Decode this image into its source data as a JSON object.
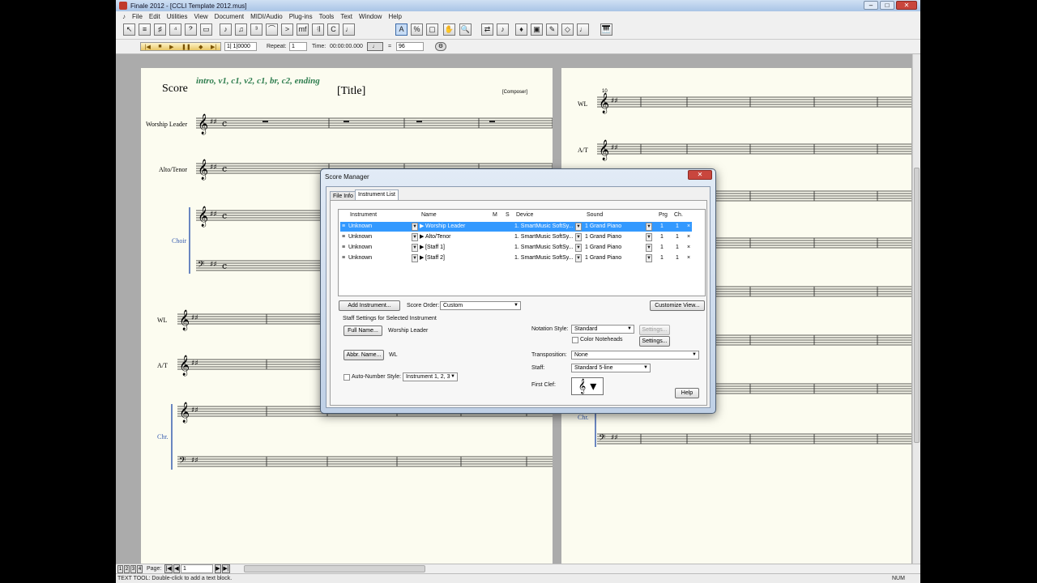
{
  "window": {
    "title": "Finale 2012 - [CCLI Template 2012.mus]"
  },
  "menu": [
    "File",
    "Edit",
    "Utilities",
    "View",
    "Document",
    "MIDI/Audio",
    "Plug-ins",
    "Tools",
    "Text",
    "Window",
    "Help"
  ],
  "tool_icons": [
    "selection-tool-icon",
    "staff-tool-icon",
    "key-signature-icon",
    "time-signature-icon",
    "clef-icon",
    "measure-icon",
    "simple-entry-icon",
    "speedy-entry-icon",
    "tuplet-icon",
    "smart-shape-icon",
    "articulation-icon",
    "expression-icon",
    "repeat-icon",
    "chord-icon",
    "lyrics-icon",
    "text-icon",
    "resize-icon",
    "page-layout-icon",
    "hand-grabber-icon",
    "zoom-icon",
    "mirror-icon",
    "note-mover-icon",
    "special-tools-icon",
    "graphics-icon",
    "mass-edit-icon",
    "ossia-icon",
    "tempo-icon",
    "hyperscribe-icon"
  ],
  "playback": {
    "measure": "1| 1|0000",
    "repeat_label": "Repeat:",
    "repeat_value": "1",
    "time_label": "Time:",
    "time_value": "00:00:00.000",
    "tempo_equals": "=",
    "tempo_value": "96"
  },
  "score": {
    "title_label": "Score",
    "form": "intro, v1, c1, v2, c1, br, c2, ending",
    "title": "[Title]",
    "composer": "[Composer]",
    "page1_staves": [
      "Worship Leader",
      "Alto/Tenor",
      "Choir",
      "WL",
      "A/T",
      "Chr."
    ],
    "page2_staves": [
      "WL",
      "A/T",
      "Chr."
    ],
    "measure_number": "10"
  },
  "dialog": {
    "title": "Score Manager",
    "tabs": [
      "File Info",
      "Instrument List"
    ],
    "active_tab": "Instrument List",
    "columns": {
      "instrument": "Instrument",
      "name": "Name",
      "m": "M",
      "s": "S",
      "device": "Device",
      "sound": "Sound",
      "prg": "Prg",
      "ch": "Ch."
    },
    "rows": [
      {
        "instrument": "Unknown",
        "name": "Worship Leader",
        "device": "1. SmartMusic SoftSy...",
        "sound": "1 Grand Piano",
        "prg": "1",
        "ch": "1",
        "x": "×"
      },
      {
        "instrument": "Unknown",
        "name": "Alto/Tenor",
        "device": "1. SmartMusic SoftSy...",
        "sound": "1 Grand Piano",
        "prg": "1",
        "ch": "1",
        "x": "×"
      },
      {
        "instrument": "Unknown",
        "name": "[Staff 1]",
        "device": "1. SmartMusic SoftSy...",
        "sound": "1 Grand Piano",
        "prg": "1",
        "ch": "1",
        "x": "×"
      },
      {
        "instrument": "Unknown",
        "name": "[Staff 2]",
        "device": "1. SmartMusic SoftSy...",
        "sound": "1 Grand Piano",
        "prg": "1",
        "ch": "1",
        "x": "×"
      }
    ],
    "add_instrument": "Add Instrument...",
    "score_order_label": "Score Order:",
    "score_order_value": "Custom",
    "customize_view": "Customize View...",
    "staff_settings_label": "Staff Settings for Selected Instrument",
    "full_name_btn": "Full Name...",
    "full_name_value": "Worship Leader",
    "abbr_name_btn": "Abbr. Name...",
    "abbr_name_value": "WL",
    "auto_number_label": "Auto-Number Style:",
    "auto_number_value": "Instrument 1, 2, 3",
    "notation_style_label": "Notation Style:",
    "notation_style_value": "Standard",
    "settings_btn": "Settings...",
    "color_noteheads_label": "Color Noteheads",
    "transposition_label": "Transposition:",
    "transposition_value": "None",
    "staff_label": "Staff:",
    "staff_value": "Standard 5-line",
    "first_clef_label": "First Clef:",
    "help_btn": "Help"
  },
  "page_nav": {
    "label": "Page:",
    "value": "1",
    "pages": [
      "1",
      "2",
      "3",
      "4"
    ]
  },
  "status": {
    "text": "TEXT TOOL: Double-click to add a text block.",
    "num": "NUM"
  }
}
